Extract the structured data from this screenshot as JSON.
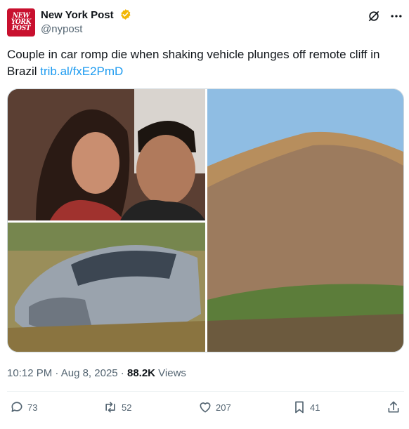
{
  "account": {
    "avatar_lines": [
      "NEW",
      "YORK",
      "POST"
    ],
    "name": "New York Post",
    "handle": "@nypost",
    "verified_color": "#f2b705"
  },
  "tweet": {
    "text": "Couple in car romp die when shaking vehicle plunges off remote cliff in Brazil ",
    "link": "trib.al/fxE2PmD"
  },
  "media": {
    "images": [
      "couple-selfie",
      "crashed-car",
      "cliff-rock"
    ]
  },
  "meta": {
    "time": "10:12 PM",
    "sep1": " · ",
    "date": "Aug 8, 2025",
    "sep2": " · ",
    "views_count": "88.2K",
    "views_label": " Views"
  },
  "actions": {
    "replies": "73",
    "reposts": "52",
    "likes": "207",
    "bookmarks": "41"
  },
  "colors": {
    "brand_red": "#c8102e",
    "link": "#1d9bf0",
    "muted": "#536471"
  }
}
